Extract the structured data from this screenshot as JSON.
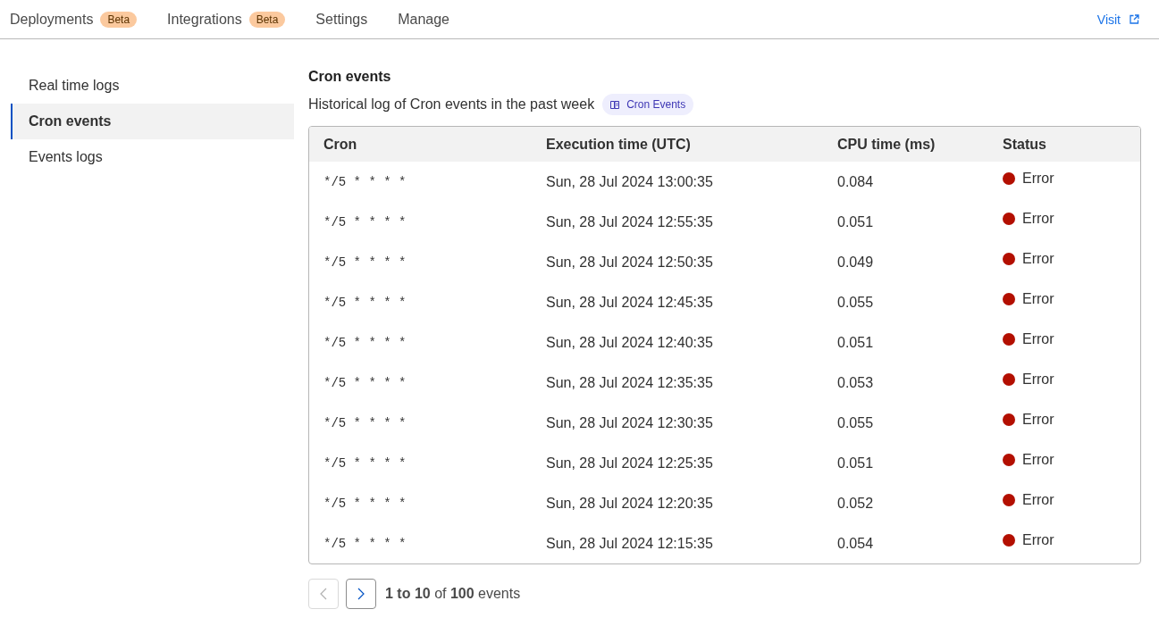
{
  "nav": {
    "tabs": [
      {
        "label": "Deployments",
        "badge": "Beta",
        "selected": false
      },
      {
        "label": "Integrations",
        "badge": "Beta",
        "selected": false
      },
      {
        "label": "Settings",
        "selected": false
      },
      {
        "label": "Manage",
        "selected": false
      }
    ],
    "visit_link": "Visit"
  },
  "sidebar": {
    "items": [
      {
        "label": "Real time logs",
        "selected": false
      },
      {
        "label": "Cron events",
        "selected": true
      },
      {
        "label": "Events logs",
        "selected": false
      }
    ]
  },
  "section": {
    "title": "Cron events",
    "description": "Historical log of Cron events in the past week",
    "docs_tag": "Cron Events"
  },
  "table": {
    "columns": [
      "Cron",
      "Execution time (UTC)",
      "CPU time (ms)",
      "Status"
    ],
    "rows": [
      {
        "cron": "*/5 * * * *",
        "time": "Sun, 28 Jul 2024 13:00:35",
        "cpu": "0.084",
        "status": "Error",
        "color": "#b30f00"
      },
      {
        "cron": "*/5 * * * *",
        "time": "Sun, 28 Jul 2024 12:55:35",
        "cpu": "0.051",
        "status": "Error",
        "color": "#b30f00"
      },
      {
        "cron": "*/5 * * * *",
        "time": "Sun, 28 Jul 2024 12:50:35",
        "cpu": "0.049",
        "status": "Error",
        "color": "#b30f00"
      },
      {
        "cron": "*/5 * * * *",
        "time": "Sun, 28 Jul 2024 12:45:35",
        "cpu": "0.055",
        "status": "Error",
        "color": "#b30f00"
      },
      {
        "cron": "*/5 * * * *",
        "time": "Sun, 28 Jul 2024 12:40:35",
        "cpu": "0.051",
        "status": "Error",
        "color": "#b30f00"
      },
      {
        "cron": "*/5 * * * *",
        "time": "Sun, 28 Jul 2024 12:35:35",
        "cpu": "0.053",
        "status": "Error",
        "color": "#b30f00"
      },
      {
        "cron": "*/5 * * * *",
        "time": "Sun, 28 Jul 2024 12:30:35",
        "cpu": "0.055",
        "status": "Error",
        "color": "#b30f00"
      },
      {
        "cron": "*/5 * * * *",
        "time": "Sun, 28 Jul 2024 12:25:35",
        "cpu": "0.051",
        "status": "Error",
        "color": "#b30f00"
      },
      {
        "cron": "*/5 * * * *",
        "time": "Sun, 28 Jul 2024 12:20:35",
        "cpu": "0.052",
        "status": "Error",
        "color": "#b30f00"
      },
      {
        "cron": "*/5 * * * *",
        "time": "Sun, 28 Jul 2024 12:15:35",
        "cpu": "0.054",
        "status": "Error",
        "color": "#b30f00"
      }
    ]
  },
  "pagination": {
    "prev_disabled": true,
    "next_disabled": false,
    "summary": "**1 to 10** of **100** events"
  }
}
